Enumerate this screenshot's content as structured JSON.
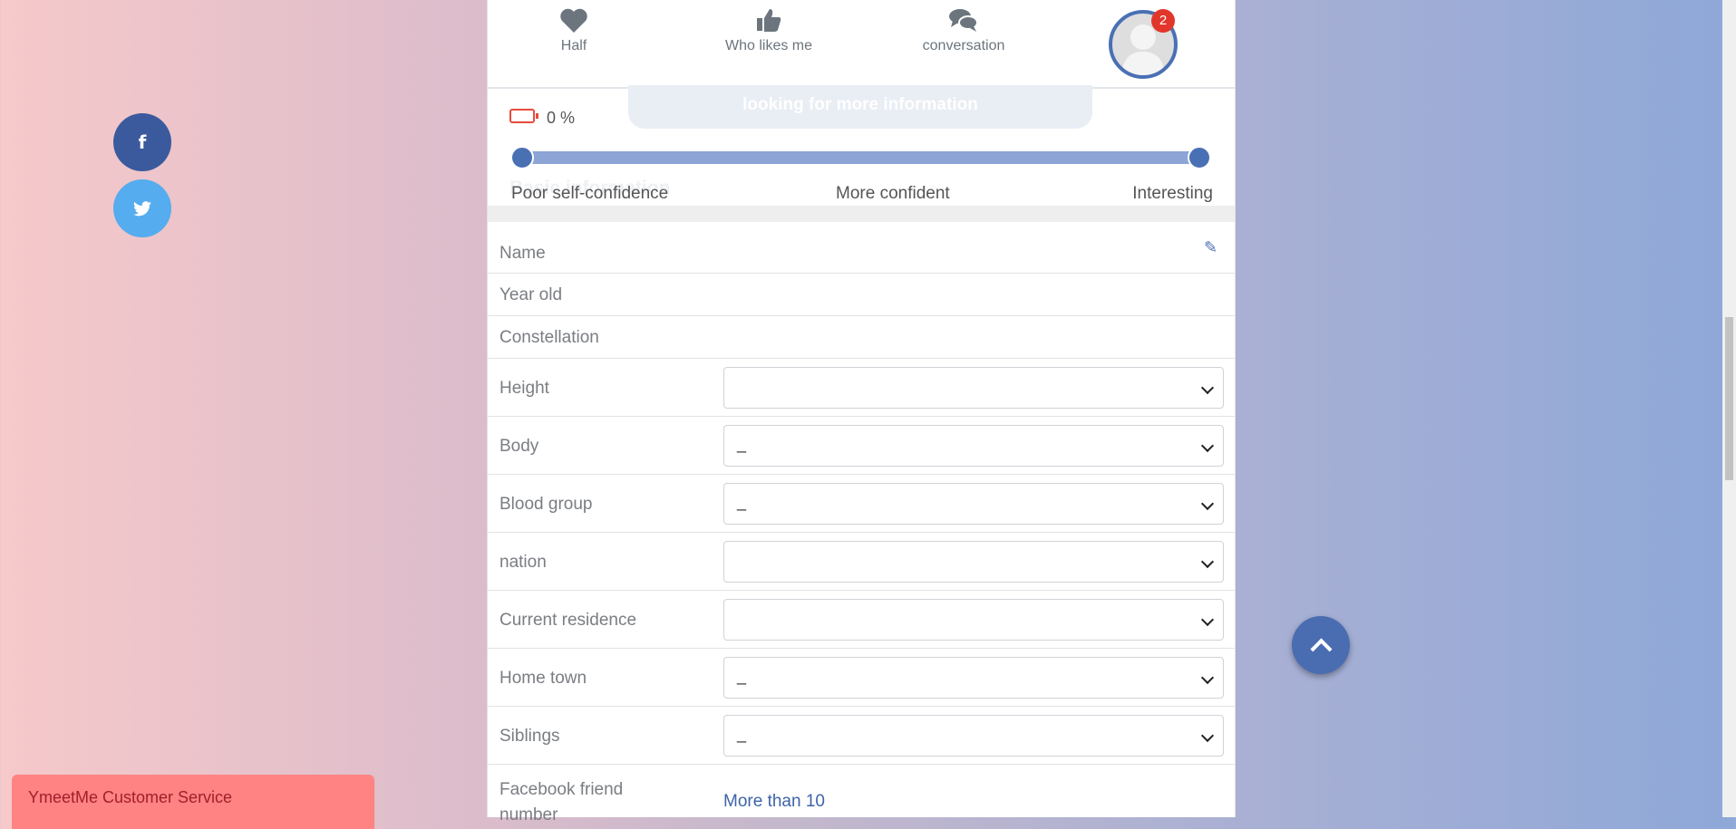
{
  "nav": [
    {
      "label": "Half",
      "icon": "heart-icon"
    },
    {
      "label": "Who likes me",
      "icon": "thumbs-up-icon"
    },
    {
      "label": "conversation",
      "icon": "chat-bubbles-icon"
    }
  ],
  "avatar_badge": "2",
  "more_info": "looking for more information",
  "battery_pct": "0 %",
  "section_heading": "Basic information",
  "slider": {
    "value": 0,
    "labels": [
      "Poor self-confidence",
      "More confident",
      "Interesting"
    ]
  },
  "fields": {
    "name": "Name",
    "year_old": "Year old",
    "constellation": "Constellation",
    "height": {
      "label": "Height",
      "value": ""
    },
    "body": {
      "label": "Body",
      "value": "_"
    },
    "blood_group": {
      "label": "Blood group",
      "value": "_"
    },
    "nation": {
      "label": "nation",
      "value": ""
    },
    "current_residence": {
      "label": "Current residence",
      "value": ""
    },
    "home_town": {
      "label": "Home town",
      "value": "_"
    },
    "siblings": {
      "label": "Siblings",
      "value": "_"
    },
    "facebook_friends": {
      "label": "Facebook friend number",
      "value": "More than 10"
    }
  },
  "customer_service": "YmeetMe Customer Service",
  "social": [
    "facebook-icon",
    "twitter-icon"
  ],
  "colors": {
    "accent": "#4a70b4",
    "badge": "#e2362a",
    "cs_bar": "#ff8383",
    "facebook": "#3b5a9e",
    "twitter": "#55acee"
  }
}
